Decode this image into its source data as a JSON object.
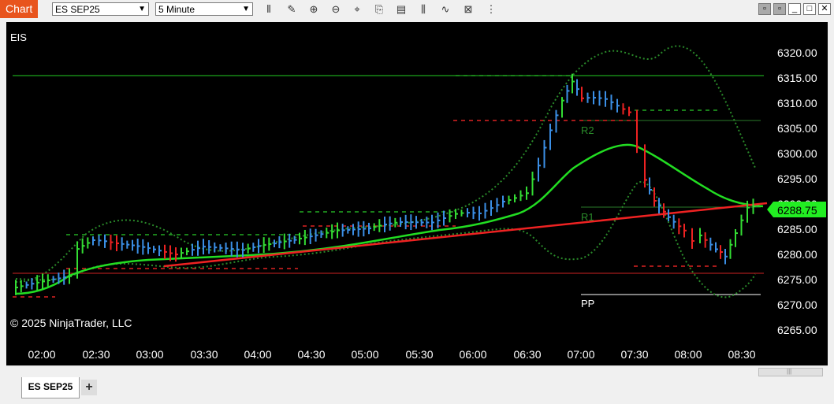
{
  "window": {
    "tab_label": "Chart"
  },
  "toolbar": {
    "instrument": "ES SEP25",
    "interval": "5 Minute",
    "tools": [
      "bar-type-icon",
      "draw-pencil-icon",
      "zoom-in-icon",
      "zoom-out-icon",
      "crosshair-icon",
      "data-box-icon",
      "properties-icon",
      "indicators-icon",
      "strategies-icon",
      "template-icon",
      "more-icon"
    ]
  },
  "chart": {
    "instrument_label": "EIS",
    "copyright": "© 2025 NinjaTrader, LLC",
    "price_marker": "6288.75",
    "y_axis_labels": [
      "6320.00",
      "6315.00",
      "6310.00",
      "6305.00",
      "6300.00",
      "6295.00",
      "6290.00",
      "6285.00",
      "6280.00",
      "6275.00",
      "6270.00",
      "6265.00"
    ],
    "x_axis_labels": [
      "02:00",
      "02:30",
      "03:00",
      "03:30",
      "04:00",
      "04:30",
      "05:00",
      "05:30",
      "06:00",
      "06:30",
      "07:00",
      "07:30",
      "08:00",
      "08:30"
    ],
    "pivot_labels": {
      "r2": "R2",
      "r1": "R1",
      "pp": "PP"
    },
    "colors": {
      "background": "#000000",
      "up": "#33dd33",
      "down": "#ee2222",
      "neutral": "#3b8fe6",
      "ma": "#22dd22",
      "trend": "#ee2222",
      "bands": "#2a8a2a",
      "marker": "#22ee22"
    }
  },
  "bottom_tabs": {
    "active": "ES SEP25",
    "add": "+"
  }
}
